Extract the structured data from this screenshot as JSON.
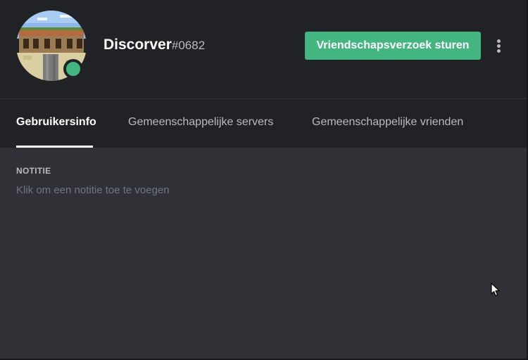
{
  "profile": {
    "username": "Discorver",
    "discriminator": "#0682",
    "status": "online",
    "status_color": "#43b581",
    "avatar_icon": "avatar-image"
  },
  "actions": {
    "friend_request_label": "Vriendschapsverzoek sturen",
    "friend_request_color": "#43b581",
    "more_icon": "more-vertical-icon"
  },
  "tabs": [
    {
      "label": "Gebruikersinfo",
      "active": true
    },
    {
      "label": "Gemeenschappelijke servers",
      "active": false
    },
    {
      "label": "Gemeenschappelijke vrienden",
      "active": false
    }
  ],
  "note": {
    "heading": "NOTITIE",
    "placeholder": "Klik om een notitie toe te voegen"
  },
  "colors": {
    "header_bg": "#202225",
    "body_bg": "#2f3136",
    "accent": "#43b581"
  }
}
